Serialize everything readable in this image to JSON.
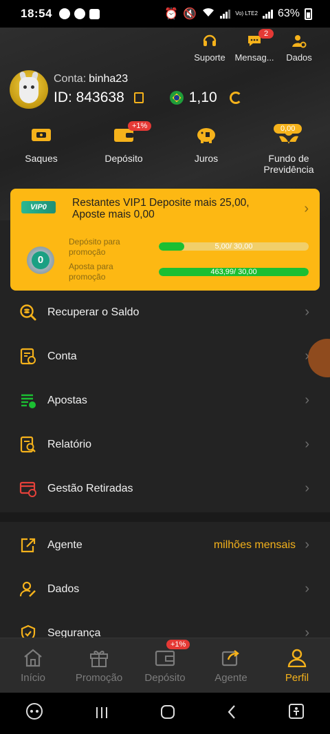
{
  "status_bar": {
    "time": "18:54",
    "battery": "63%",
    "network": "Vo) LTE2"
  },
  "top_actions": [
    {
      "label": "Suporte",
      "icon": "headset-icon"
    },
    {
      "label": "Mensag...",
      "icon": "chat-icon",
      "badge": "2"
    },
    {
      "label": "Dados",
      "icon": "user-gear-icon"
    }
  ],
  "profile": {
    "account_label": "Conta:",
    "username": "binha23",
    "id_text": "ID: 843638",
    "balance": "1,10"
  },
  "quick_actions": [
    {
      "label": "Saques",
      "icon": "ticket-icon"
    },
    {
      "label": "Depósito",
      "icon": "wallet-icon",
      "badge": "+1%"
    },
    {
      "label": "Juros",
      "icon": "piggy-bank-icon"
    },
    {
      "label": "Fundo de Previdência",
      "icon": "fund-icon",
      "badge": "0,00"
    }
  ],
  "vip": {
    "tag": "VIP0",
    "message": "Restantes  VIP1  Deposite mais  25,00, Aposte mais 0,00",
    "level": "0",
    "deposit_label": "Depósito para promoção",
    "deposit_progress": "5,00/ 30,00",
    "deposit_fraction": 0.17,
    "bet_label": "Aposta para promoção",
    "bet_progress": "463,99/ 30,00",
    "bet_fraction": 1.0
  },
  "menu": [
    {
      "label": "Recuperar o Saldo",
      "icon": "coin-search-icon",
      "color": "#f5b21b"
    },
    {
      "label": "Conta",
      "icon": "document-icon",
      "color": "#f5b21b"
    },
    {
      "label": "Apostas",
      "icon": "list-icon",
      "color": "#1bbf32"
    },
    {
      "label": "Relatório",
      "icon": "report-icon",
      "color": "#f5b21b"
    },
    {
      "label": "Gestão Retiradas",
      "icon": "card-icon",
      "color": "#e5413a"
    }
  ],
  "menu2": [
    {
      "label": "Agente",
      "icon": "share-icon",
      "extra": "milhões mensais"
    },
    {
      "label": "Dados",
      "icon": "user-edit-icon"
    },
    {
      "label": "Segurança",
      "icon": "shield-icon"
    }
  ],
  "tabs": [
    {
      "label": "Início",
      "icon": "home-icon"
    },
    {
      "label": "Promoção",
      "icon": "gift-icon"
    },
    {
      "label": "Depósito",
      "icon": "wallet-icon",
      "badge": "+1%"
    },
    {
      "label": "Agente",
      "icon": "share-icon"
    },
    {
      "label": "Perfil",
      "icon": "profile-icon",
      "active": true
    }
  ],
  "colors": {
    "accent": "#f5b21b",
    "background": "#232323",
    "vip_card": "#fdb813",
    "progress": "#1bbf32"
  }
}
